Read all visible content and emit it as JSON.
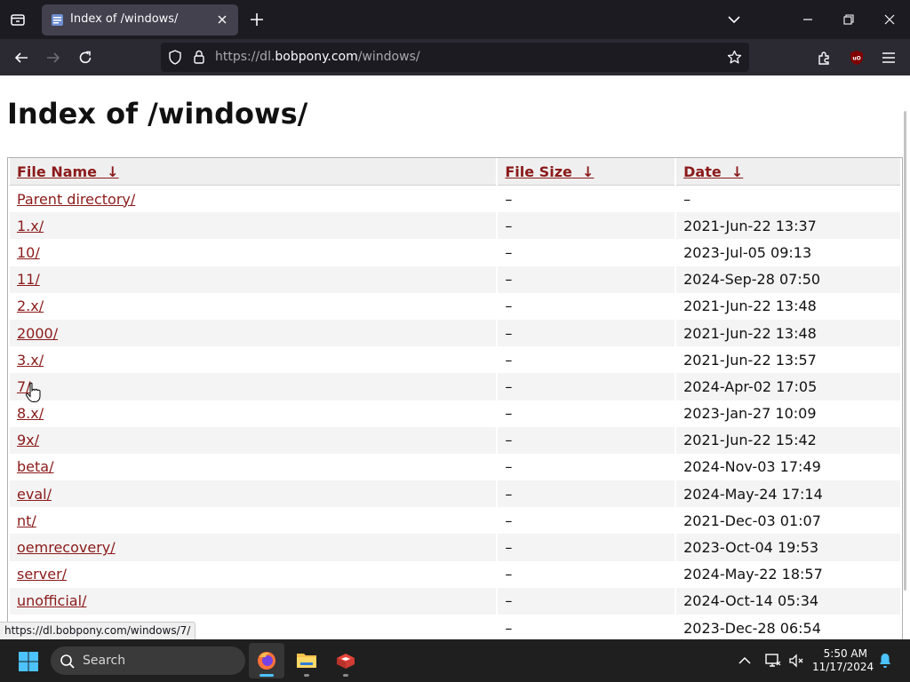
{
  "browser": {
    "tab": {
      "title": "Index of /windows/"
    },
    "urlbar": {
      "prefix": "https://dl.",
      "domain": "bobpony.com",
      "suffix": "/windows/"
    },
    "status_link": "https://dl.bobpony.com/windows/7/"
  },
  "page": {
    "title": "Index of /windows/",
    "columns": {
      "name": "File Name",
      "size": "File Size",
      "date": "Date",
      "sort_glyph": "↓"
    },
    "rows": [
      {
        "name": "Parent directory/",
        "size": "–",
        "date": "–"
      },
      {
        "name": "1.x/",
        "size": "–",
        "date": "2021-Jun-22 13:37"
      },
      {
        "name": "10/",
        "size": "–",
        "date": "2023-Jul-05 09:13"
      },
      {
        "name": "11/",
        "size": "–",
        "date": "2024-Sep-28 07:50"
      },
      {
        "name": "2.x/",
        "size": "–",
        "date": "2021-Jun-22 13:48"
      },
      {
        "name": "2000/",
        "size": "–",
        "date": "2021-Jun-22 13:48"
      },
      {
        "name": "3.x/",
        "size": "–",
        "date": "2021-Jun-22 13:57"
      },
      {
        "name": "7/",
        "size": "–",
        "date": "2024-Apr-02 17:05"
      },
      {
        "name": "8.x/",
        "size": "–",
        "date": "2023-Jan-27 10:09"
      },
      {
        "name": "9x/",
        "size": "–",
        "date": "2021-Jun-22 15:42"
      },
      {
        "name": "beta/",
        "size": "–",
        "date": "2024-Nov-03 17:49"
      },
      {
        "name": "eval/",
        "size": "–",
        "date": "2024-May-24 17:14"
      },
      {
        "name": "nt/",
        "size": "–",
        "date": "2021-Dec-03 01:07"
      },
      {
        "name": "oemrecovery/",
        "size": "–",
        "date": "2023-Oct-04 19:53"
      },
      {
        "name": "server/",
        "size": "–",
        "date": "2024-May-22 18:57"
      },
      {
        "name": "unofficial/",
        "size": "–",
        "date": "2024-Oct-14 05:34"
      },
      {
        "name": "",
        "size": "–",
        "date": "2023-Dec-28 06:54"
      }
    ]
  },
  "taskbar": {
    "search_label": "Search",
    "time": "5:50 AM",
    "date": "11/17/2024",
    "apps": [
      "firefox-icon",
      "file-explorer-icon",
      "app-icon"
    ]
  },
  "colors": {
    "link": "#8b1a1a",
    "accent": "#4cc2ff"
  }
}
